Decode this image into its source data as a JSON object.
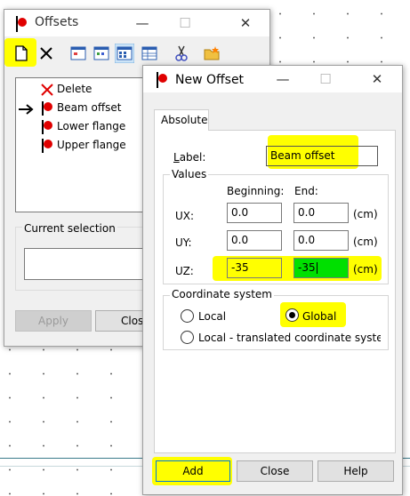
{
  "offsets_window": {
    "title": "Offsets",
    "list_items": [
      {
        "label": "Delete",
        "icon": "delete-x-icon"
      },
      {
        "label": "Beam offset",
        "icon": "offset-icon",
        "current": true
      },
      {
        "label": "Lower flange",
        "icon": "offset-icon"
      },
      {
        "label": "Upper flange",
        "icon": "offset-icon"
      }
    ],
    "current_selection_label": "Current selection",
    "apply_label": "Apply",
    "close_label": "Close",
    "toolbar_icons": [
      "new-icon",
      "delete-icon",
      "view-list-icon",
      "view-detail-icon",
      "view-grid-icon",
      "view-table-icon",
      "scissors-icon",
      "folder-star-icon"
    ]
  },
  "new_offset": {
    "title": "New Offset",
    "tab": "Absolute",
    "label_caption": "Label:",
    "label_value": "Beam offset",
    "values_group": "Values",
    "col_beginning": "Beginning:",
    "col_end": "End:",
    "rows": [
      {
        "name": "UX:",
        "begin": "0.0",
        "end": "0.0",
        "unit": "(cm)"
      },
      {
        "name": "UY:",
        "begin": "0.0",
        "end": "0.0",
        "unit": "(cm)"
      },
      {
        "name": "UZ:",
        "begin": "-35",
        "end": "-35",
        "unit": "(cm)"
      }
    ],
    "coord_group": "Coordinate system",
    "radio_local": "Local",
    "radio_global": "Global",
    "radio_local_translated": "Local - translated coordinate system",
    "selected_coord": "Global",
    "add_label": "Add",
    "close_label": "Close",
    "help_label": "Help"
  },
  "colors": {
    "highlight": "#ffff00",
    "active_field": "#00e000",
    "icon_red": "#e00000",
    "focus_border": "#0078d7"
  }
}
